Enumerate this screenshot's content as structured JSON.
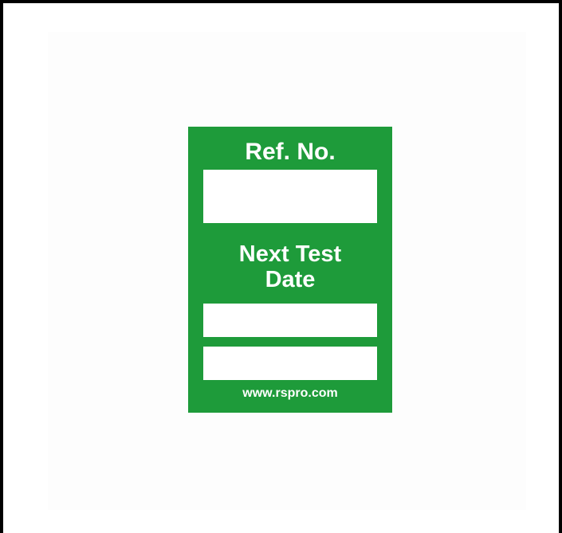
{
  "label": {
    "ref_title": "Ref. No.",
    "next_test_line1": "Next Test",
    "next_test_line2": "Date",
    "website": "www.rspro.com",
    "color": "#1e9b3a"
  }
}
